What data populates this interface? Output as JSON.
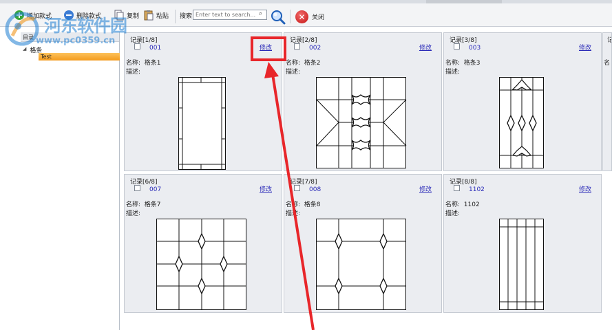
{
  "toolbar": {
    "add_label": "增加款式",
    "delete_label": "删除款式",
    "copy_label": "复制",
    "paste_label": "粘贴",
    "search_label": "搜索",
    "search_placeholder": "Enter text to search...",
    "close_label": "关闭"
  },
  "tree": {
    "header": "目录",
    "root_label": "格条",
    "child_label": "Test"
  },
  "labels": {
    "name_prefix": "名称:",
    "desc_prefix": "描述:",
    "edit": "修改"
  },
  "cards": [
    {
      "header": "记录[1/8]",
      "code": "001",
      "name": "格条1"
    },
    {
      "header": "记录[2/8]",
      "code": "002",
      "name": "格条2"
    },
    {
      "header": "记录[3/8]",
      "code": "003",
      "name": "格条3"
    },
    {
      "header": "记录[6/8]",
      "code": "007",
      "name": "格条7"
    },
    {
      "header": "记录[7/8]",
      "code": "008",
      "name": "格条8"
    },
    {
      "header": "记录[8/8]",
      "code": "1102",
      "name": "1102"
    }
  ],
  "partial_card": {
    "header": "记",
    "name_prefix": "名"
  },
  "watermark": {
    "title": "河东软件园",
    "url": "www.pc0359.cn"
  },
  "colors": {
    "link": "#2a2ab8",
    "selection": "#f49a1c",
    "annotation": "#e8262a"
  }
}
